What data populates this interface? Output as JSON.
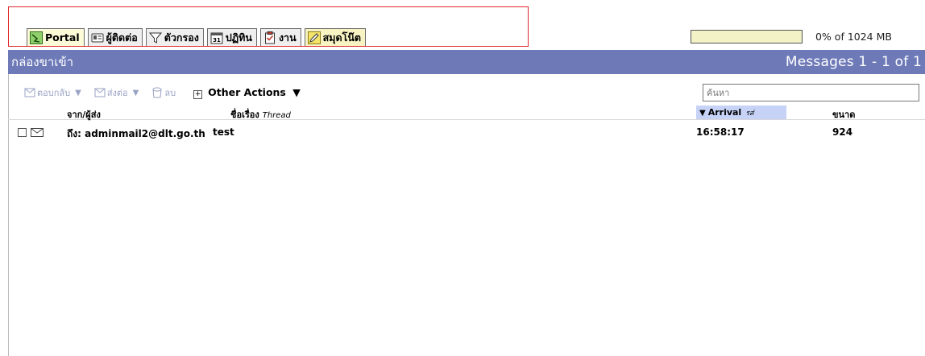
{
  "tabs": [
    {
      "label": "Portal",
      "icon": "portal-icon"
    },
    {
      "label": "ผู้ติดต่อ",
      "icon": "contacts-card-icon"
    },
    {
      "label": "ตัวกรอง",
      "icon": "filter-funnel-icon"
    },
    {
      "label": "ปฏิทิน",
      "icon": "calendar-31-icon"
    },
    {
      "label": "งาน",
      "icon": "tasks-clipboard-icon"
    },
    {
      "label": "สมุดโน๊ต",
      "icon": "notes-pencil-icon"
    }
  ],
  "quota": {
    "text": "0% of 1024 MB",
    "fraction_used": 0
  },
  "folder": {
    "title": "กล่องขาเข้า",
    "count_text": "Messages 1 - 1 of 1"
  },
  "toolbar": {
    "reply": "ตอบกลับ",
    "forward": "ส่งต่อ",
    "delete": "ลบ",
    "other_actions": "Other Actions",
    "search_placeholder": "ค้นหา"
  },
  "columns": {
    "from": "จาก/ผู้ส่ง",
    "subject": "ชื่อเรื่อง",
    "subject_mode": "Thread",
    "arrival": "Arrival",
    "arrival_sub": "รส่",
    "size": "ขนาด"
  },
  "messages": [
    {
      "from": "ถึง: adminmail2@dlt.go.th",
      "subject": "test",
      "arrival": "16:58:17",
      "size": "924"
    }
  ],
  "colors": {
    "titlebar": "#6d7ab7",
    "highlight": "#e0262b",
    "sort_header": "#c6d3f6"
  }
}
